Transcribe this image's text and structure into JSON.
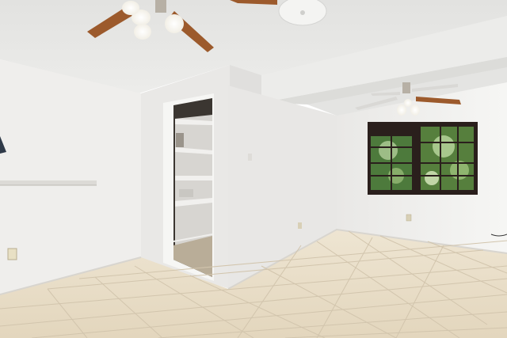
{
  "scene": {
    "description_tag": "",
    "colors": {
      "ceiling": "#e9e9e7",
      "wall_left": "#f0efed",
      "wall_mid": "#e6e5e3",
      "wall_right": "#f3f3f1",
      "floor": "#e7dcc6",
      "grout": "#cfc2aa",
      "window_frame": "#2a1f1c",
      "fan_blade": "#9c5a2c",
      "tree_green": "#4f7b3a"
    }
  }
}
